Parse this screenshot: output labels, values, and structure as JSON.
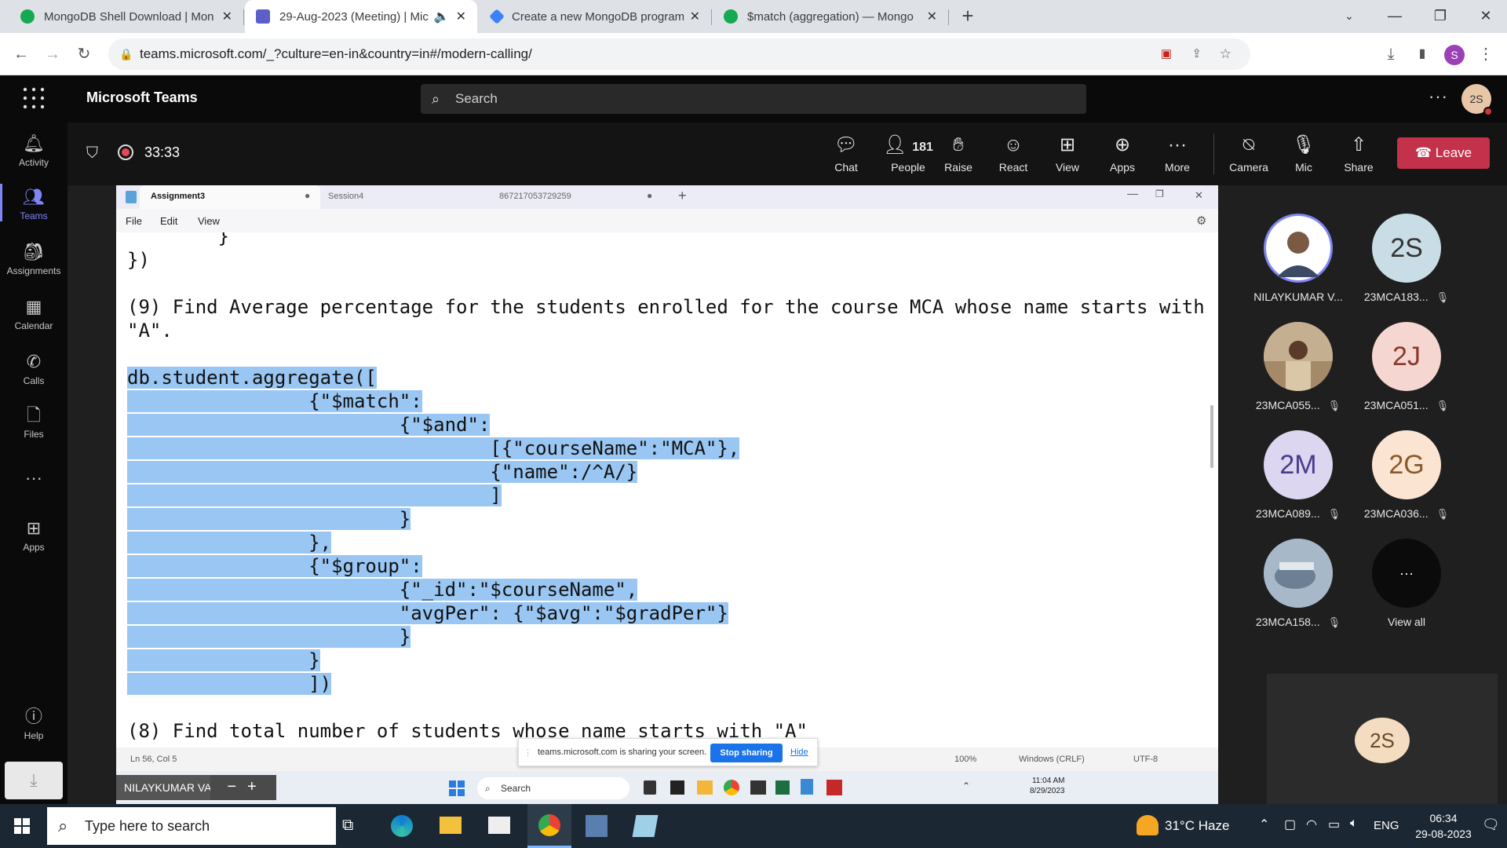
{
  "browser": {
    "tabs": [
      {
        "title": "MongoDB Shell Download | Mon",
        "color": "#13aa52"
      },
      {
        "title": "29-Aug-2023 (Meeting) | Mic",
        "color": "#5b5fc7"
      },
      {
        "title": "Create a new MongoDB program",
        "color": "#3b82f6"
      },
      {
        "title": "$match (aggregation) — Mongo",
        "color": "#13aa52"
      }
    ],
    "url": "teams.microsoft.com/_?culture=en-in&country=in#/modern-calling/",
    "profile_initial": "S"
  },
  "teams": {
    "app_name": "Microsoft Teams",
    "search_placeholder": "Search",
    "user_initials": "2S",
    "rail": [
      {
        "label": "Activity",
        "icon": "bell-icon"
      },
      {
        "label": "Teams",
        "icon": "teams-icon"
      },
      {
        "label": "Assignments",
        "icon": "assignments-icon"
      },
      {
        "label": "Calendar",
        "icon": "calendar-icon"
      },
      {
        "label": "Calls",
        "icon": "phone-icon"
      },
      {
        "label": "Files",
        "icon": "file-icon"
      },
      {
        "label": "Apps",
        "icon": "apps-icon"
      },
      {
        "label": "Help",
        "icon": "help-icon"
      }
    ],
    "meeting": {
      "timer": "33:33",
      "people_count": "181",
      "buttons": [
        "Chat",
        "People",
        "Raise",
        "React",
        "View",
        "Apps",
        "More",
        "Camera",
        "Mic",
        "Share"
      ],
      "leave_label": "Leave"
    },
    "presenter_name": "NILAYKUMAR VAIDYA",
    "participants": [
      {
        "name": "NILAYKUMAR V...",
        "initials": "",
        "color": "#ffffff",
        "muted": false
      },
      {
        "name": "23MCA183...",
        "initials": "2S",
        "color": "#c8dde5",
        "muted": true
      },
      {
        "name": "23MCA055...",
        "initials": "",
        "color": "#a58a6a",
        "muted": true
      },
      {
        "name": "23MCA051...",
        "initials": "2J",
        "color": "#f6d6d0",
        "muted": true
      },
      {
        "name": "23MCA089...",
        "initials": "2M",
        "color": "#dcd6f0",
        "muted": true
      },
      {
        "name": "23MCA036...",
        "initials": "2G",
        "color": "#fbe5d2",
        "muted": true
      },
      {
        "name": "23MCA158...",
        "initials": "",
        "color": "#8aa3bd",
        "muted": true
      },
      {
        "name": "View all",
        "initials": "···",
        "color": "#0b0b0b",
        "muted": false
      }
    ],
    "self_tile_initials": "2S"
  },
  "shared": {
    "notepad_tabs": [
      "Assignment3",
      "Session4",
      "867217053729259"
    ],
    "menu": [
      "File",
      "Edit",
      "View"
    ],
    "code_lines": [
      "        }",
      "})",
      "",
      "(9) Find Average percentage for the students enrolled for the course MCA whose name starts with",
      "\"A\".",
      "",
      "db.student.aggregate([",
      "                {\"$match\":",
      "                        {\"$and\":",
      "                                [{\"courseName\":\"MCA\"},",
      "                                {\"name\":/^A/}",
      "                                ]",
      "                        }",
      "                },",
      "                {\"$group\":",
      "                        {\"_id\":\"$courseName\",",
      "                        \"avgPer\": {\"$avg\":\"$gradPer\"}",
      "                        }",
      "                }",
      "                ])",
      "",
      "(8) Find total number of students whose name starts with \"A\""
    ],
    "status": {
      "position": "Ln 56, Col 5",
      "zoom": "100%",
      "eol": "Windows (CRLF)",
      "encoding": "UTF-8"
    },
    "sharing_text": "teams.microsoft.com is sharing your screen.",
    "stop_sharing": "Stop sharing",
    "hide": "Hide",
    "inner_search": "Search",
    "inner_time": "11:04 AM",
    "inner_date": "8/29/2023"
  },
  "windows": {
    "search_placeholder": "Type here to search",
    "weather": "31°C  Haze",
    "lang": "ENG",
    "time": "06:34",
    "date": "29-08-2023"
  }
}
